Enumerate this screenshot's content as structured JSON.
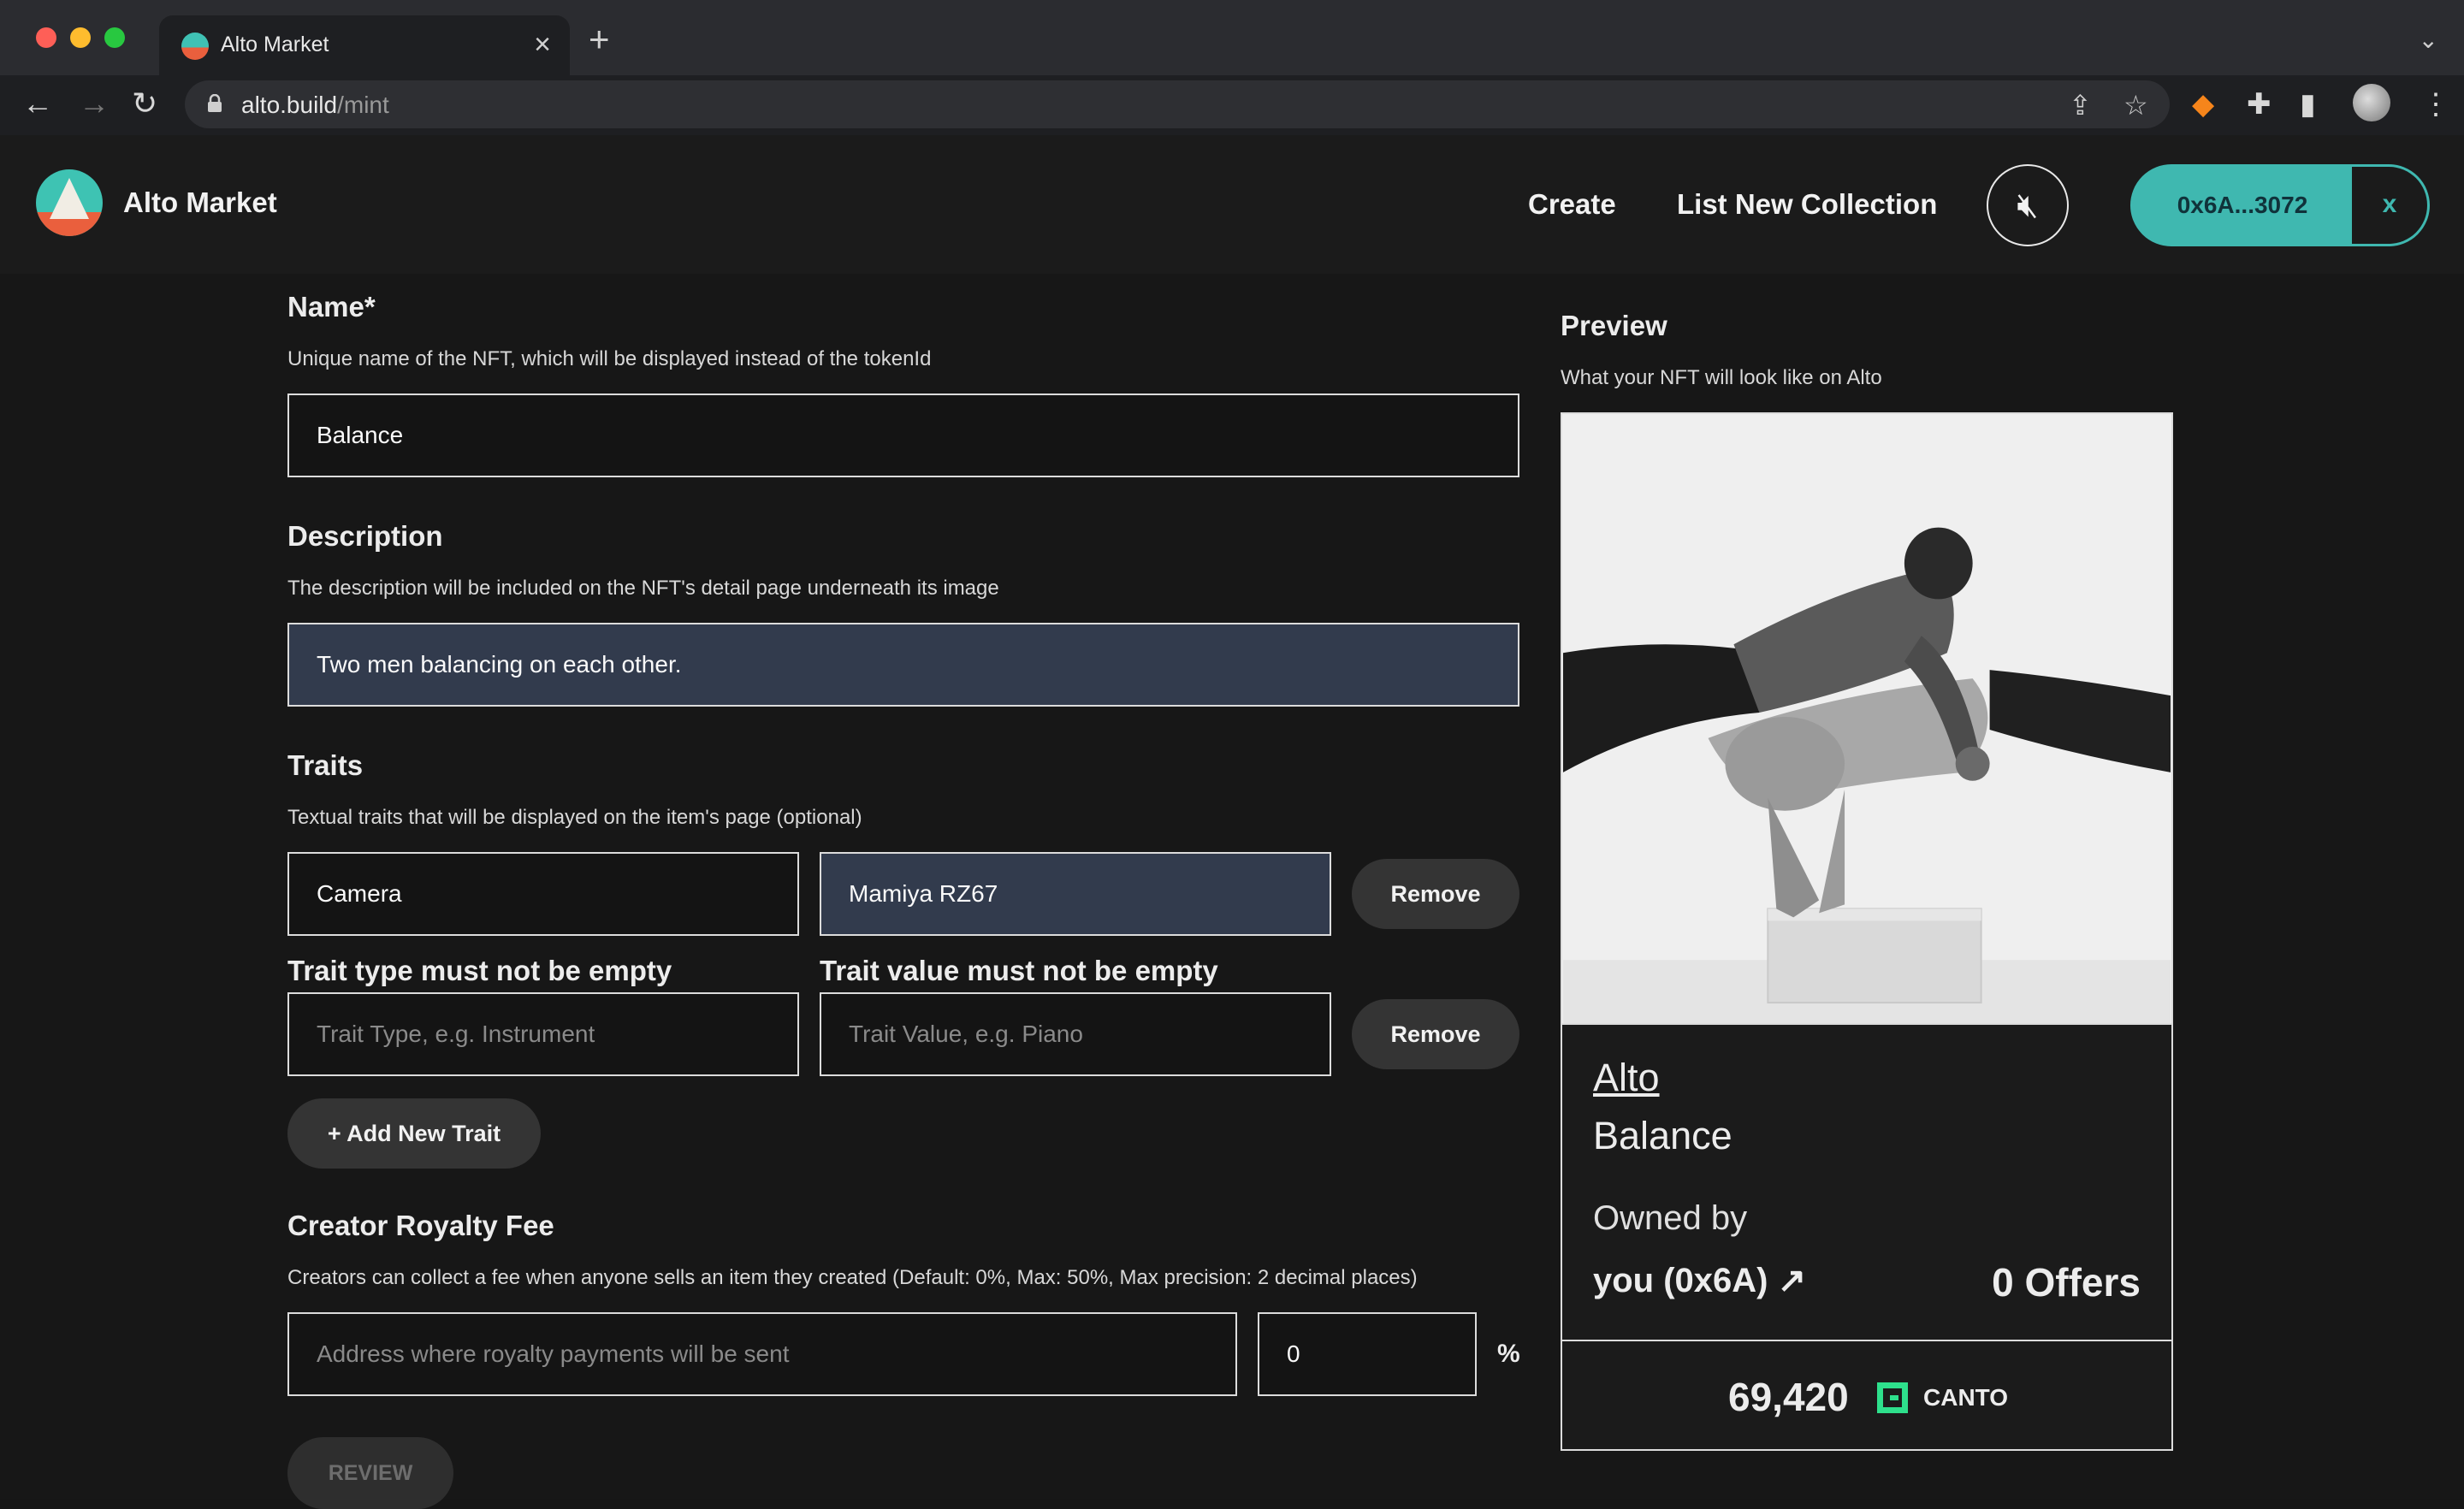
{
  "browser": {
    "tab_title": "Alto Market",
    "url_host": "alto.build",
    "url_path": "/mint"
  },
  "header": {
    "brand": "Alto Market",
    "nav": [
      "Create",
      "List New Collection"
    ],
    "wallet_address": "0x6A...3072",
    "wallet_disconnect": "x"
  },
  "form": {
    "name": {
      "label": "Name*",
      "help": "Unique name of the NFT, which will be displayed instead of the tokenId",
      "value": "Balance"
    },
    "description": {
      "label": "Description",
      "help": "The description will be included on the NFT's detail page underneath its image",
      "value": "Two men balancing on each other."
    },
    "traits": {
      "label": "Traits",
      "help": "Textual traits that will be displayed on the item's page (optional)",
      "rows": [
        {
          "type": "Camera",
          "value": "Mamiya RZ67",
          "remove": "Remove"
        },
        {
          "type_error": "Trait type must not be empty",
          "value_error": "Trait value must not be empty",
          "type_placeholder": "Trait Type, e.g. Instrument",
          "value_placeholder": "Trait Value, e.g. Piano",
          "remove": "Remove"
        }
      ],
      "add_button": "+ Add New Trait"
    },
    "royalty": {
      "label": "Creator Royalty Fee",
      "help": "Creators can collect a fee when anyone sells an item they created (Default: 0%, Max: 50%, Max precision: 2 decimal places)",
      "address_placeholder": "Address where royalty payments will be sent",
      "percent_value": "0",
      "percent_symbol": "%"
    },
    "review_button": "REVIEW"
  },
  "preview": {
    "label": "Preview",
    "help": "What your NFT will look like on Alto",
    "collection": "Alto",
    "name": "Balance",
    "owned_by_label": "Owned by",
    "owner": "you (0x6A)",
    "offers": "0 Offers",
    "price": "69,420",
    "currency": "CANTO"
  },
  "colors": {
    "accent": "#3fb8b0",
    "canto": "#2ee08c",
    "input_filled": "#323b4d"
  }
}
